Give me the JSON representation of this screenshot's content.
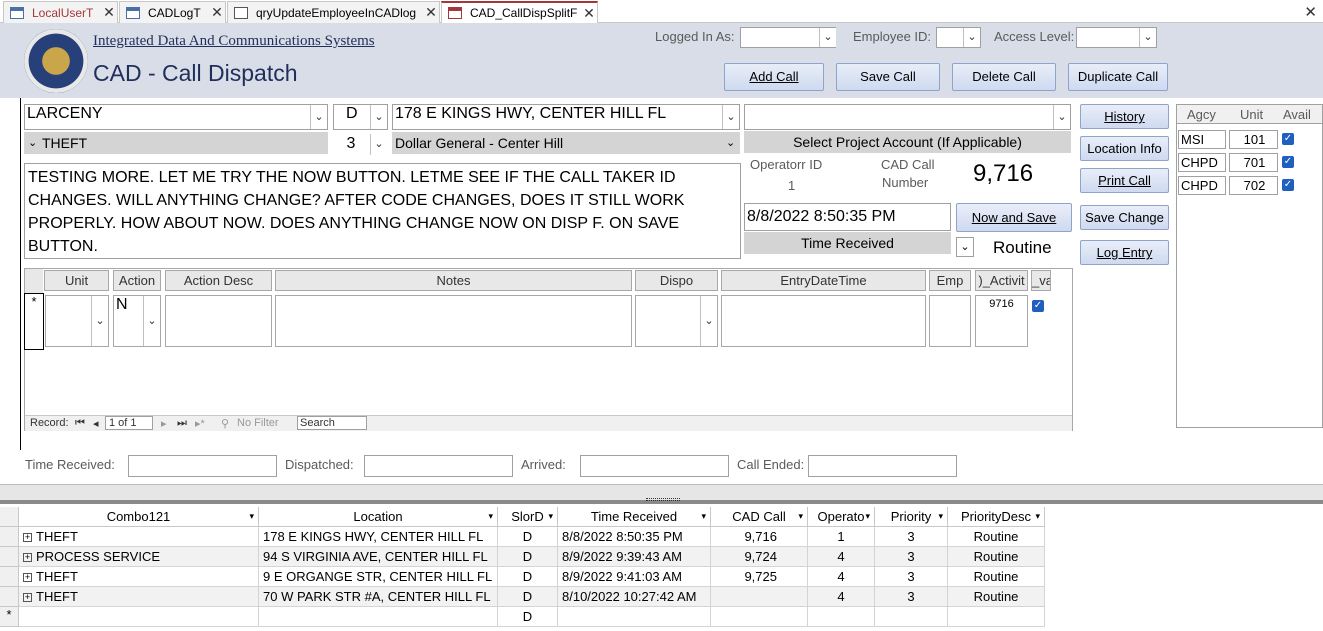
{
  "tabs": [
    {
      "label": "LocalUserT",
      "icon": "table-icon"
    },
    {
      "label": "CADLogT",
      "icon": "table-icon"
    },
    {
      "label": "qryUpdateEmployeeInCADlog",
      "icon": "query-icon"
    },
    {
      "label": "CAD_CallDispSplitF",
      "icon": "form-icon"
    }
  ],
  "header": {
    "org_name": "Integrated Data And Communications Systems",
    "title": "CAD - Call Dispatch",
    "logged_in_label": "Logged In As:",
    "employee_id_label": "Employee ID:",
    "access_level_label": "Access Level:",
    "buttons": {
      "add": "Add Call",
      "save": "Save Call",
      "delete": "Delete Call",
      "duplicate": "Duplicate Call"
    }
  },
  "call": {
    "call_type": "LARCENY",
    "call_subtype": "THEFT",
    "status_code": "D",
    "priority_num": "3",
    "address": "178 E KINGS HWY, CENTER HILL FL",
    "business": "Dollar General - Center Hill",
    "project_account": "",
    "project_account_label": "Select Project Account (If Applicable)",
    "operator_label": "Operatorr ID",
    "operator_id": "1",
    "cad_call_label_1": "CAD Call",
    "cad_call_label_2": "Number",
    "cad_number": "9,716",
    "narrative": "TESTING MORE.  LET ME TRY THE NOW BUTTON. LETME SEE IF THE CALL TAKER ID CHANGES.  WILL ANYTHING CHANGE?  AFTER CODE CHANGES, DOES IT STILL WORK PROPERLY.  HOW ABOUT NOW.  DOES ANYTHING CHANGE NOW ON DISP F.  ON SAVE BUTTON.",
    "time_received": "8/8/2022 8:50:35 PM",
    "time_received_label": "Time Received",
    "now_save_label": "Now and Save",
    "priority_desc": "Routine"
  },
  "side_buttons": {
    "history": "History",
    "location": "Location Info",
    "print": "Print Call",
    "save_change": "Save Change",
    "log_entry": "Log Entry"
  },
  "units_panel": {
    "headers": [
      "Agcy",
      "Unit",
      "Avail"
    ],
    "rows": [
      {
        "agency": "MSI",
        "unit": "101",
        "avail": true
      },
      {
        "agency": "CHPD",
        "unit": "701",
        "avail": true
      },
      {
        "agency": "CHPD",
        "unit": "702",
        "avail": true
      }
    ]
  },
  "subform": {
    "headers": [
      "Unit",
      "Action",
      "Action Desc",
      "Notes",
      "Dispo",
      "EntryDateTime",
      "Emp",
      ")_Activit",
      "_va"
    ],
    "new_row": {
      "action": "N",
      "activity": "9716"
    },
    "nav": {
      "record_label": "Record:",
      "position": "1 of 1",
      "filter": "No Filter",
      "search": "Search"
    }
  },
  "times": {
    "received": "Time Received:",
    "dispatched": "Dispatched:",
    "arrived": "Arrived:",
    "ended": "Call Ended:"
  },
  "datasheet": {
    "headers": [
      "Combo121",
      "Location",
      "SlorD",
      "Time Received",
      "CAD Call",
      "Operato",
      "Priority",
      "PriorityDesc"
    ],
    "rows": [
      [
        "THEFT",
        "178 E KINGS HWY, CENTER HILL FL",
        "D",
        "8/8/2022 8:50:35 PM",
        "9,716",
        "1",
        "3",
        "Routine"
      ],
      [
        "PROCESS SERVICE",
        "94 S VIRGINIA AVE, CENTER HILL FL",
        "D",
        "8/9/2022 9:39:43 AM",
        "9,724",
        "4",
        "3",
        "Routine"
      ],
      [
        "THEFT",
        "9 E ORGANGE STR, CENTER HILL FL",
        "D",
        "8/9/2022 9:41:03 AM",
        "9,725",
        "4",
        "3",
        "Routine"
      ],
      [
        "THEFT",
        "70 W PARK STR #A, CENTER HILL FL",
        "D",
        "8/10/2022 10:27:42 AM",
        "",
        "4",
        "3",
        "Routine"
      ]
    ],
    "new_row_slord": "D"
  },
  "colors": {
    "header_bg": "#d9dde8",
    "button_bg": "#cfdaf0",
    "active_tab": "#a4373a",
    "check": "#1f5fbf"
  }
}
